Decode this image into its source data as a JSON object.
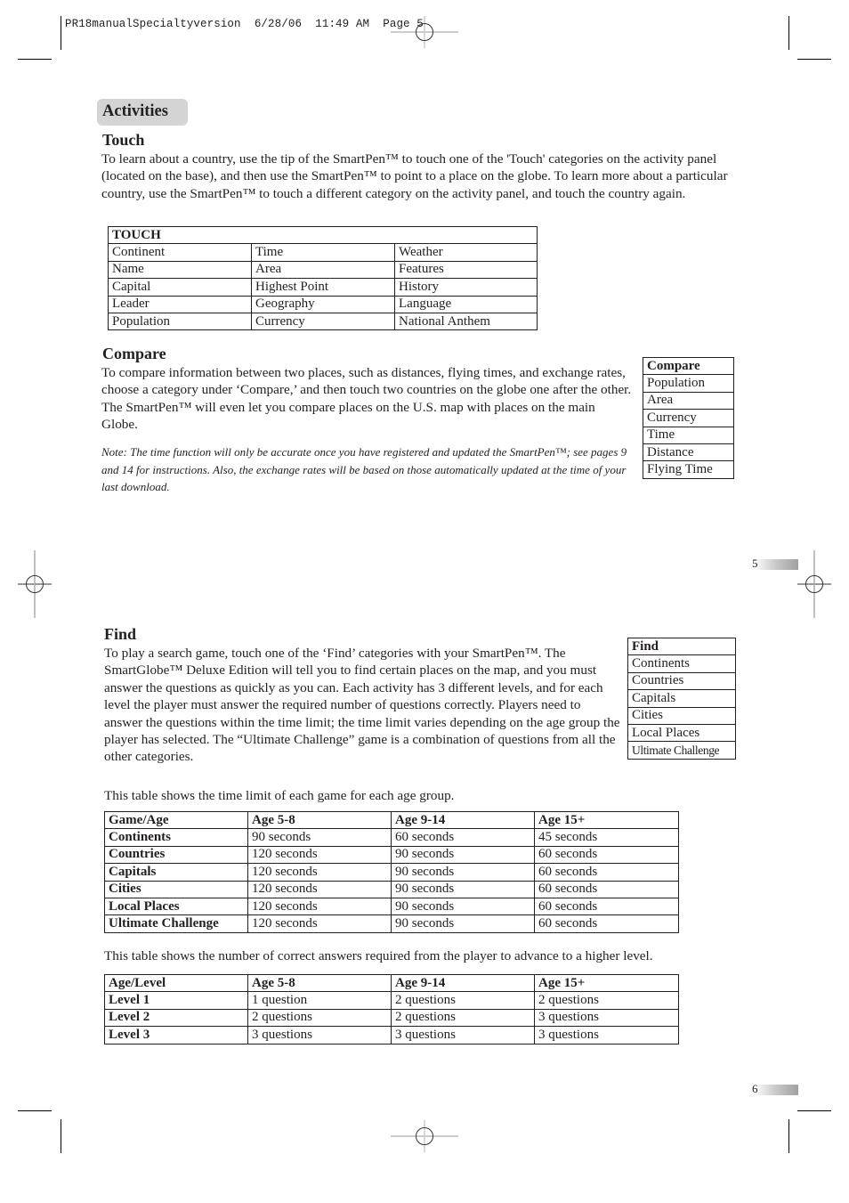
{
  "slug": {
    "text": "PR18manualSpecialtyversion  6/28/06  11:49 AM  Page 5"
  },
  "section_title": "Activities",
  "touch": {
    "heading": "Touch",
    "paragraph": "To learn about a country, use the tip of the SmartPen™ to touch one of the 'Touch' categories on the activity panel (located on the base), and then use the SmartPen™ to point to a place on the globe. To learn more about a particular country, use the SmartPen™ to touch a different category on the activity panel, and touch the country again.",
    "table": {
      "header": "TOUCH",
      "rows": [
        [
          "Continent",
          "Time",
          "Weather"
        ],
        [
          "Name",
          "Area",
          "Features"
        ],
        [
          "Capital",
          "Highest Point",
          "History"
        ],
        [
          "Leader",
          "Geography",
          "Language"
        ],
        [
          "Population",
          "Currency",
          "National Anthem"
        ]
      ]
    }
  },
  "compare": {
    "heading": "Compare",
    "paragraph": "To compare information between two places, such as distances, flying times, and exchange rates, choose a category under ‘Compare,’ and then touch two countries on the globe one after the other. The SmartPen™ will even let you compare places on the U.S. map with places on the main Globe.",
    "note": "Note: The time function will only be accurate once you have registered and updated the SmartPen™; see pages 9 and 14 for instructions. Also, the exchange rates will be based on those automatically updated at the time of your last download.",
    "table": {
      "header": "Compare",
      "items": [
        "Population",
        "Area",
        "Currency",
        "Time",
        "Distance",
        "Flying Time"
      ]
    }
  },
  "find": {
    "heading": "Find",
    "paragraph": "To play a search game, touch one of the ‘Find’ categories with your SmartPen™. The SmartGlobe™ Deluxe Edition will tell you to find certain places on the map, and you must answer the questions as quickly as you can. Each activity has 3 different levels, and for each level the player must answer the required number of questions correctly. Players need to answer the questions within the time limit; the time limit varies depending on the age group the player has selected. The “Ultimate Challenge” game is a combination of questions from all the other categories.",
    "table": {
      "header": "Find",
      "items": [
        "Continents",
        "Countries",
        "Capitals",
        "Cities",
        "Local Places",
        "Ultimate Challenge"
      ]
    },
    "time_intro": "This table shows the time limit of each game for each age group.",
    "time_table": {
      "headers": [
        "Game/Age",
        "Age 5-8",
        "Age 9-14",
        "Age 15+"
      ],
      "rows": [
        [
          "Continents",
          "90 seconds",
          "60 seconds",
          "45 seconds"
        ],
        [
          "Countries",
          "120 seconds",
          "90 seconds",
          "60 seconds"
        ],
        [
          "Capitals",
          "120 seconds",
          "90 seconds",
          "60 seconds"
        ],
        [
          "Cities",
          "120 seconds",
          "90 seconds",
          "60 seconds"
        ],
        [
          "Local Places",
          "120 seconds",
          "90 seconds",
          "60 seconds"
        ],
        [
          "Ultimate Challenge",
          "120 seconds",
          "90 seconds",
          "60 seconds"
        ]
      ]
    },
    "level_intro": "This table shows the number of correct answers required from the player to advance to a higher level.",
    "level_table": {
      "headers": [
        "Age/Level",
        "Age 5-8",
        "Age 9-14",
        "Age 15+"
      ],
      "rows": [
        [
          "Level 1",
          "1 question",
          "2 questions",
          "2 questions"
        ],
        [
          "Level 2",
          "2 questions",
          "2 questions",
          "3 questions"
        ],
        [
          "Level 3",
          "3 questions",
          "3 questions",
          "3 questions"
        ]
      ]
    }
  },
  "page_numbers": [
    "5",
    "6"
  ]
}
